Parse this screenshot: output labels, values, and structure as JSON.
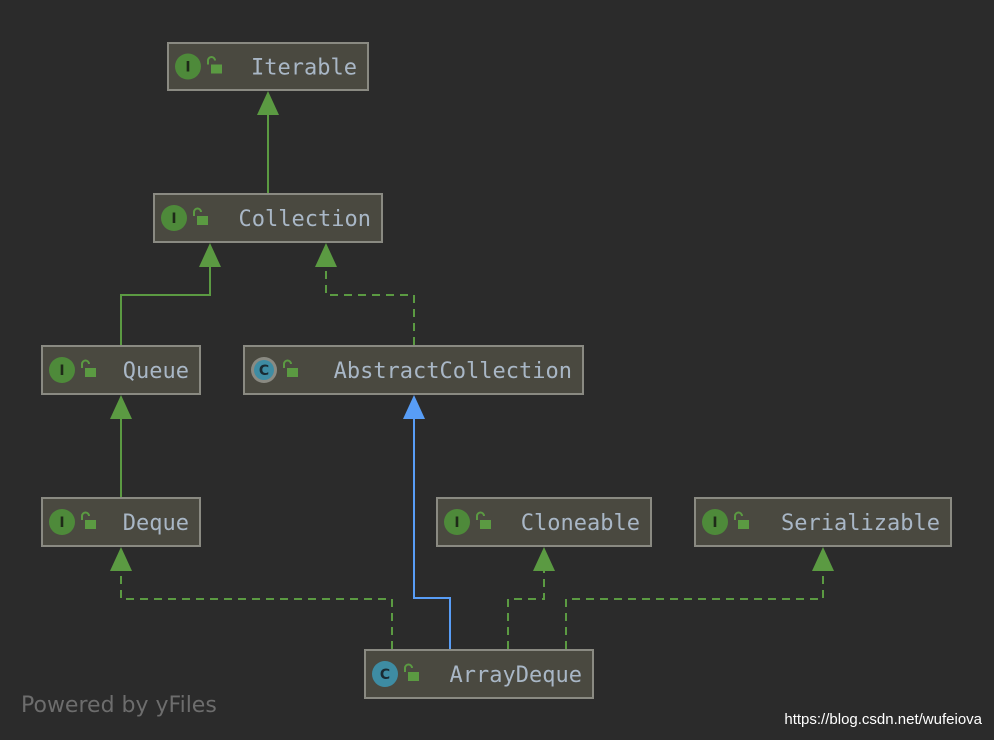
{
  "nodes": [
    {
      "id": "iterable",
      "name": "Iterable",
      "kind": "interface"
    },
    {
      "id": "collection",
      "name": "Collection",
      "kind": "interface"
    },
    {
      "id": "queue",
      "name": "Queue",
      "kind": "interface"
    },
    {
      "id": "abstractcollection",
      "name": "AbstractCollection",
      "kind": "abstract-class"
    },
    {
      "id": "deque",
      "name": "Deque",
      "kind": "interface"
    },
    {
      "id": "cloneable",
      "name": "Cloneable",
      "kind": "interface"
    },
    {
      "id": "serializable",
      "name": "Serializable",
      "kind": "interface"
    },
    {
      "id": "arraydeque",
      "name": "ArrayDeque",
      "kind": "class"
    }
  ],
  "edges": [
    {
      "from": "collection",
      "to": "iterable",
      "type": "extends"
    },
    {
      "from": "queue",
      "to": "collection",
      "type": "extends"
    },
    {
      "from": "abstractcollection",
      "to": "collection",
      "type": "implements"
    },
    {
      "from": "deque",
      "to": "queue",
      "type": "extends"
    },
    {
      "from": "arraydeque",
      "to": "deque",
      "type": "implements"
    },
    {
      "from": "arraydeque",
      "to": "abstractcollection",
      "type": "class-extends"
    },
    {
      "from": "arraydeque",
      "to": "cloneable",
      "type": "implements"
    },
    {
      "from": "arraydeque",
      "to": "serializable",
      "type": "implements"
    }
  ],
  "badges": {
    "interface": "I",
    "class": "C",
    "abstract-class": "C"
  },
  "colors": {
    "background": "#2b2b2b",
    "node_fill": "#4a4940",
    "node_border": "#8a8a82",
    "text": "#a9b7c6",
    "interface_badge": "#4e8a3a",
    "class_badge": "#3e8ca3",
    "edge_green": "#5b9a42",
    "edge_blue": "#589df6",
    "lock": "#5b9a42"
  },
  "footer": {
    "powered_by": "Powered by yFiles",
    "watermark": "https://blog.csdn.net/wufeiova"
  }
}
